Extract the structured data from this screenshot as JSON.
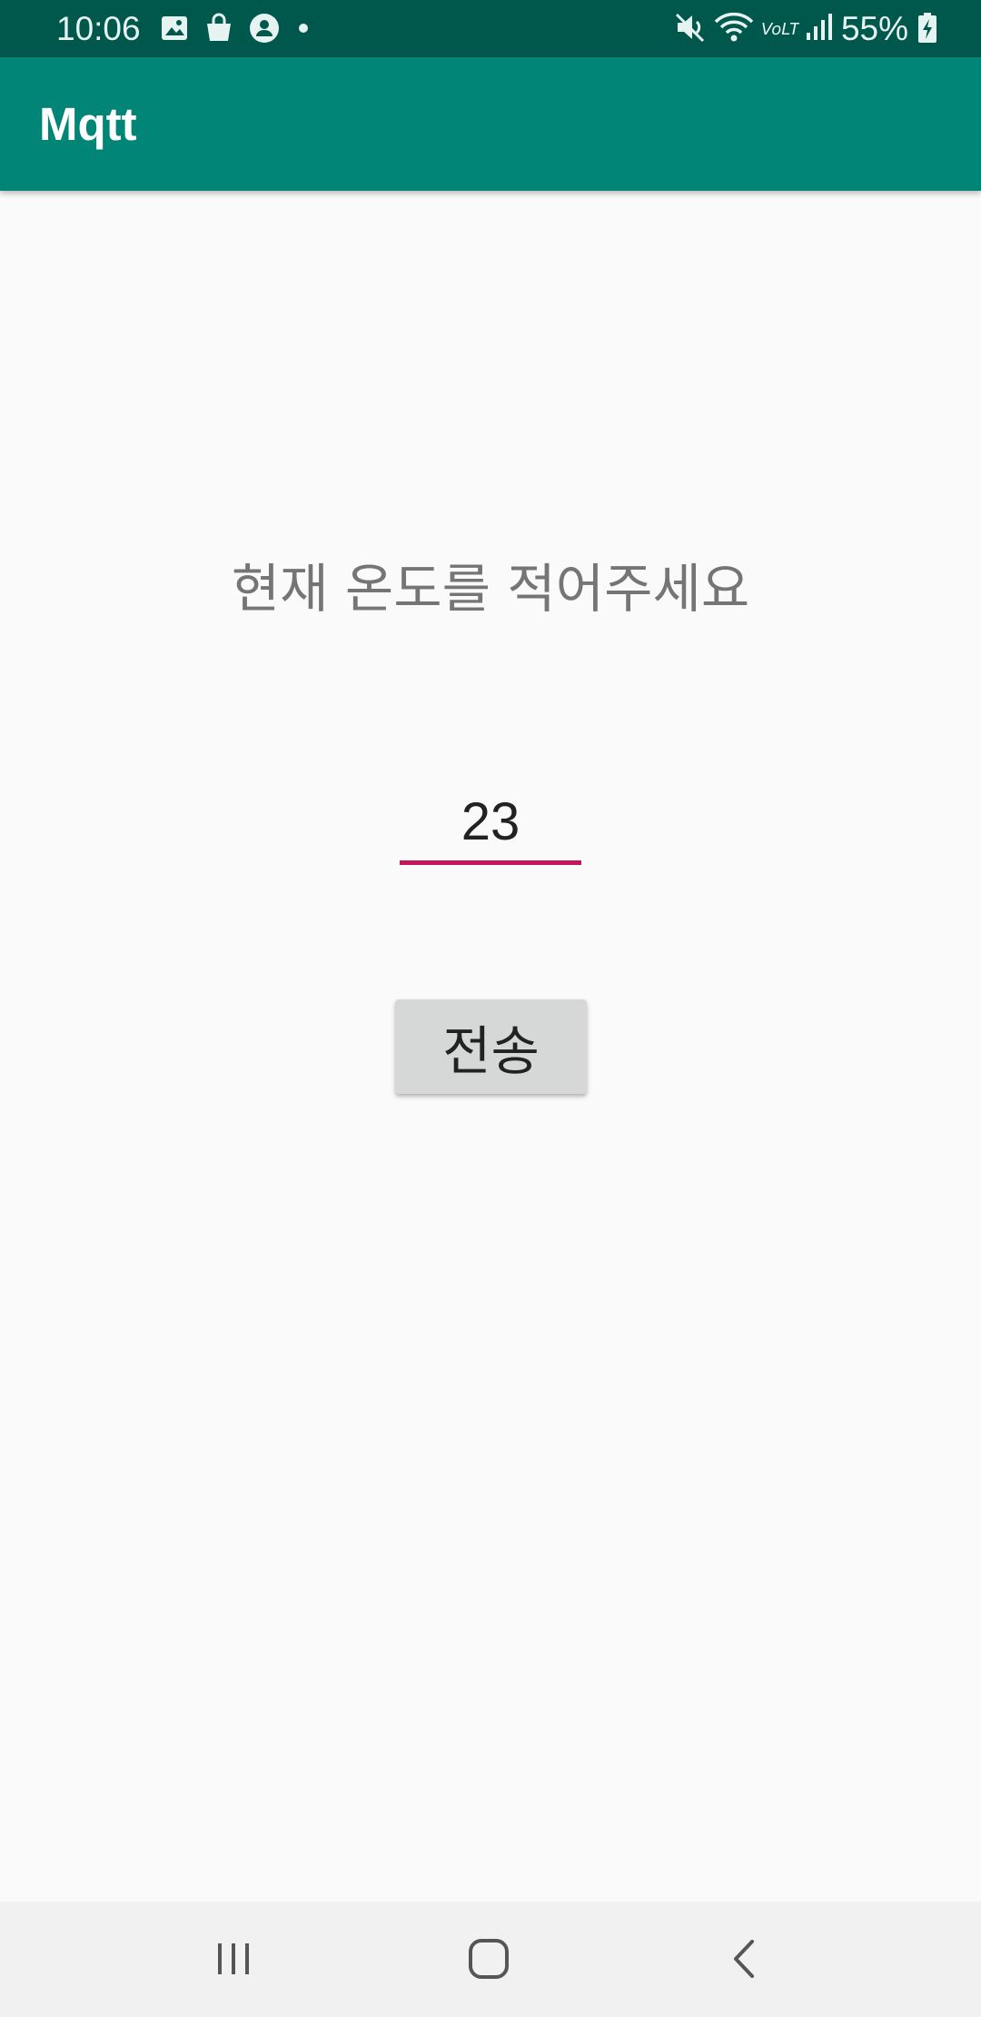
{
  "status_bar": {
    "time": "10:06",
    "battery": "55%",
    "left_icons": [
      "image-icon",
      "shopping-bag-icon",
      "account-circle-icon",
      "notification-dot-icon"
    ],
    "right_icons": [
      "mute-icon",
      "wifi-icon",
      "volte-icon",
      "signal-icon",
      "battery-charging-icon"
    ]
  },
  "app_bar": {
    "title": "Mqtt",
    "color": "#008577",
    "status_color": "#00574b"
  },
  "main": {
    "prompt": "현재 온도를 적어주세요",
    "temperature_input": {
      "value": "23"
    },
    "send_button": {
      "label": "전송"
    },
    "accent_color": "#c2185b"
  },
  "nav_bar": {
    "buttons": [
      "recent-apps-icon",
      "home-icon",
      "back-icon"
    ]
  }
}
